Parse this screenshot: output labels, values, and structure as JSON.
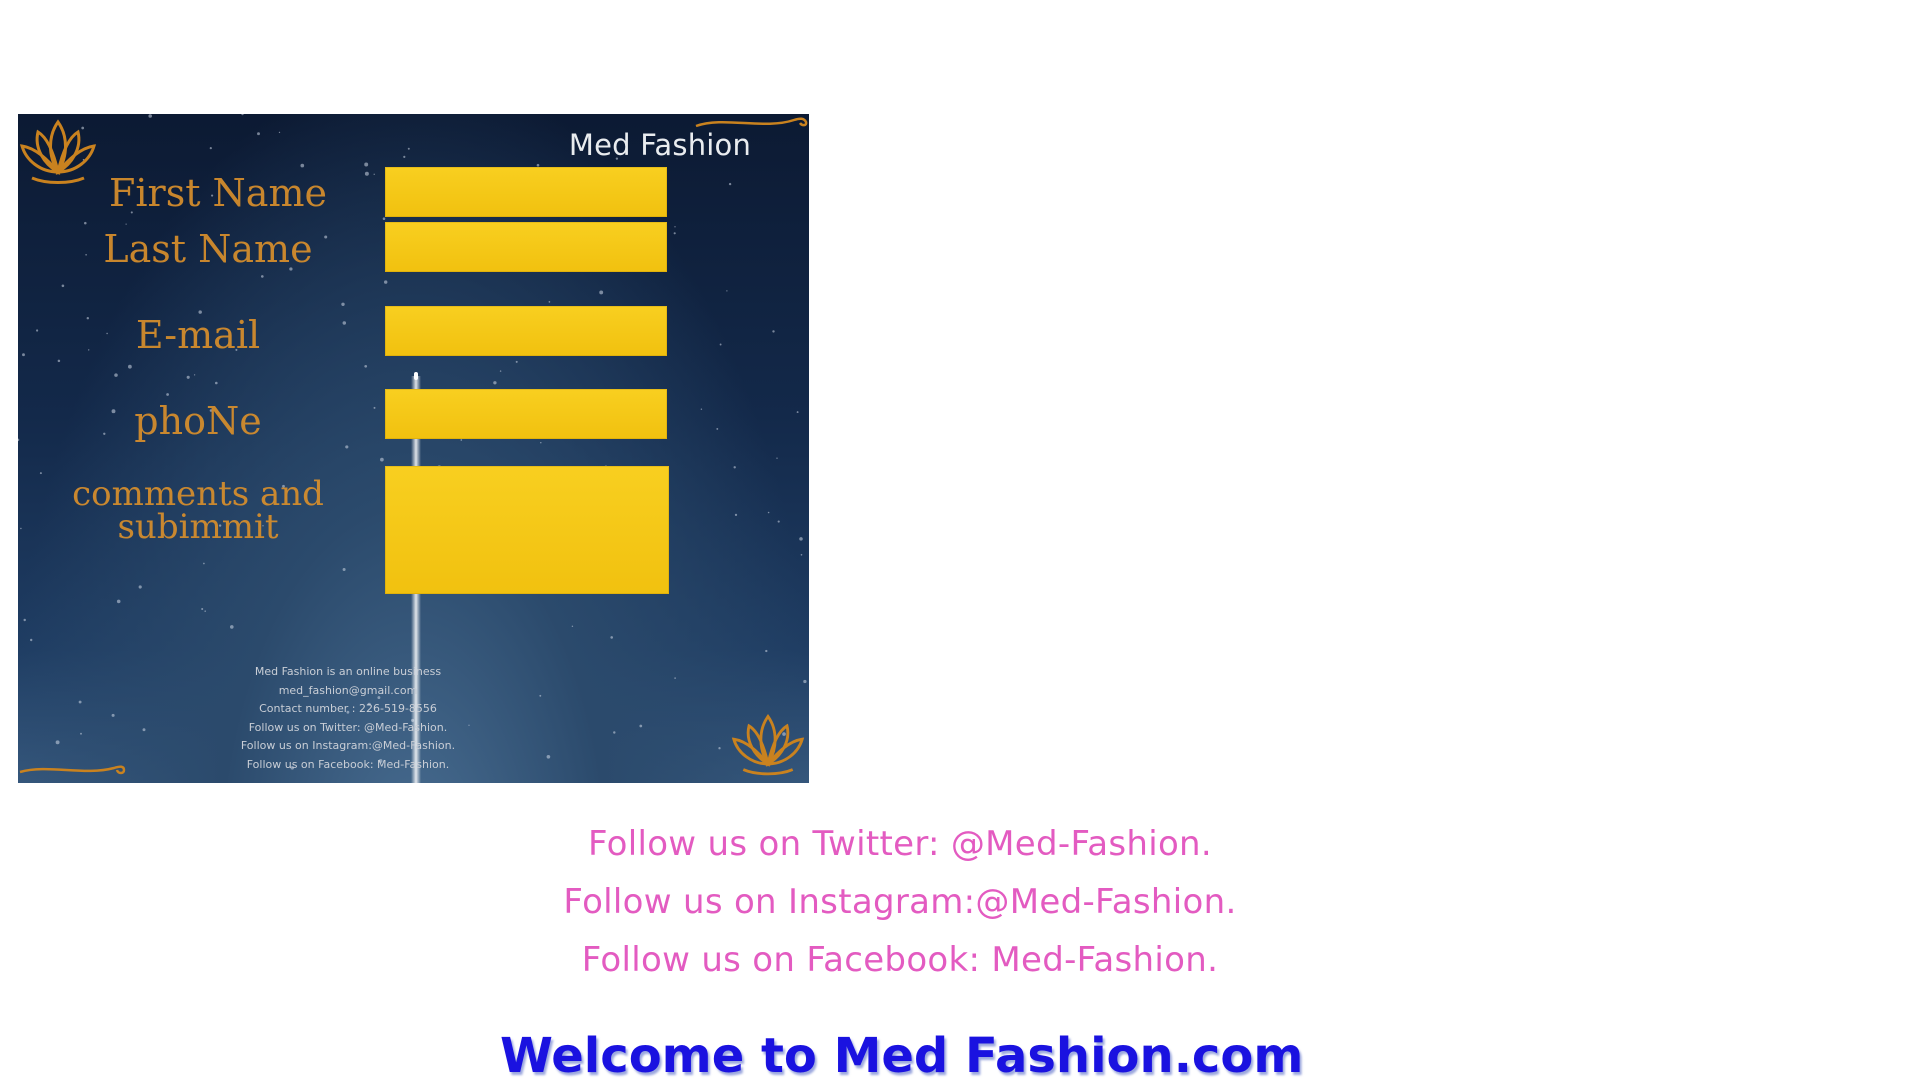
{
  "poster": {
    "brand": "Med Fashion",
    "labels": {
      "first_name": "First Name",
      "last_name": "Last Name",
      "email": "E-mail",
      "phone": "phoNe",
      "comments_line1": "comments and",
      "comments_line2": "subimmit"
    },
    "fields": {
      "first_name": "",
      "last_name": "",
      "email": "",
      "phone": "",
      "comments": ""
    },
    "info_lines": [
      "Med Fashion is an online business",
      "med_fashion@gmail.com",
      "Contact number : 226-519-8556",
      "Follow us on Twitter: @Med-Fashion.",
      "Follow us on Instagram:@Med-Fashion.",
      "Follow us on Facebook: Med-Fashion."
    ],
    "colors": {
      "field_fill": "#f5c518",
      "label_text": "#d88f2c",
      "background": "#13294a"
    }
  },
  "social": {
    "twitter": "Follow us on Twitter: @Med-Fashion.",
    "instagram": "Follow us on Instagram:@Med-Fashion.",
    "facebook": "Follow us on Facebook: Med-Fashion.",
    "color": "#e35bc1"
  },
  "welcome": {
    "text": "Welcome to Med Fashion.com",
    "color": "#1a12e0"
  },
  "icons": [
    "lotus-icon",
    "swirl-ornament-icon"
  ]
}
